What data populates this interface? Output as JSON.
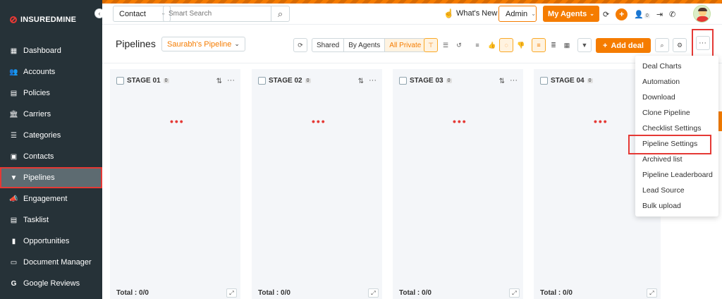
{
  "brand": {
    "name": "INSUREDMINE"
  },
  "sidebar": {
    "items": [
      {
        "label": "Dashboard",
        "icon": "dashboard-icon",
        "active": false
      },
      {
        "label": "Accounts",
        "icon": "accounts-icon",
        "active": false
      },
      {
        "label": "Policies",
        "icon": "policies-icon",
        "active": false
      },
      {
        "label": "Carriers",
        "icon": "carriers-icon",
        "active": false
      },
      {
        "label": "Categories",
        "icon": "categories-icon",
        "active": false
      },
      {
        "label": "Contacts",
        "icon": "contacts-icon",
        "active": false
      },
      {
        "label": "Pipelines",
        "icon": "pipelines-icon",
        "active": true
      },
      {
        "label": "Engagement",
        "icon": "engagement-icon",
        "active": false
      },
      {
        "label": "Tasklist",
        "icon": "tasklist-icon",
        "active": false
      },
      {
        "label": "Opportunities",
        "icon": "opportunities-icon",
        "active": false
      },
      {
        "label": "Document Manager",
        "icon": "folder-icon",
        "active": false
      },
      {
        "label": "Google Reviews",
        "icon": "google-icon",
        "active": false
      }
    ]
  },
  "header": {
    "search_type": "Contact",
    "search_placeholder": "Smart Search",
    "whats_new": "What's New",
    "role": "Admin",
    "my_agents": "My Agents",
    "notification_count": "0"
  },
  "toolbar": {
    "title": "Pipelines",
    "pipeline_name": "Saurabh's Pipeline",
    "view_filters": [
      "Shared",
      "By Agents",
      "All Private"
    ],
    "active_filter": "All Private",
    "add_deal": "Add deal",
    "more": "···"
  },
  "stages": [
    {
      "name": "STAGE 01",
      "count": "0",
      "total": "Total : 0/0"
    },
    {
      "name": "STAGE 02",
      "count": "0",
      "total": "Total : 0/0"
    },
    {
      "name": "STAGE 03",
      "count": "0",
      "total": "Total : 0/0"
    },
    {
      "name": "STAGE 04",
      "count": "0",
      "total": "Total : 0/0"
    }
  ],
  "menu": {
    "items": [
      "Deal Charts",
      "Automation",
      "Download",
      "Clone Pipeline",
      "Checklist Settings",
      "Pipeline Settings",
      "Archived list",
      "Pipeline Leaderboard",
      "Lead Source",
      "Bulk upload"
    ],
    "highlighted": "Pipeline Settings"
  },
  "colors": {
    "accent": "#f57c00",
    "sidebar": "#263238",
    "highlight": "#e53935"
  }
}
